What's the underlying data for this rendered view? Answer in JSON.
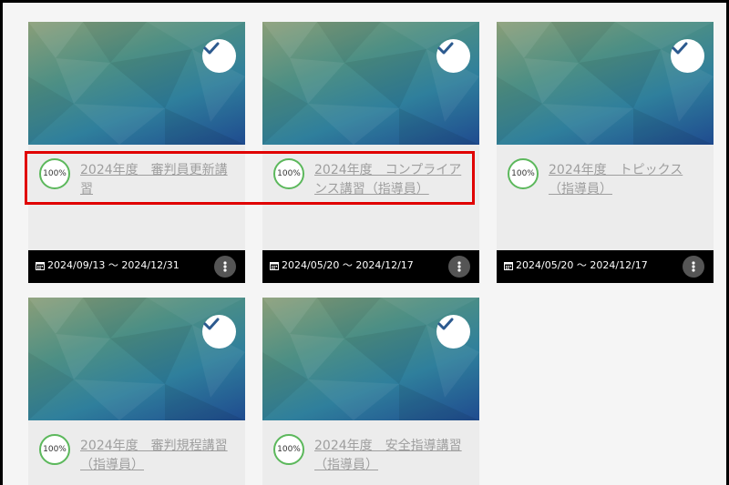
{
  "cards": [
    {
      "progress": "100%",
      "title": "2024年度　審判員更新講習",
      "date_range": "2024/09/13 ～ 2024/12/31",
      "completed": true
    },
    {
      "progress": "100%",
      "title": "2024年度　コンプライアンス講習（指導員）",
      "date_range": "2024/05/20 ～ 2024/12/17",
      "completed": true
    },
    {
      "progress": "100%",
      "title": "2024年度　トピックス（指導員）",
      "date_range": "2024/05/20 ～ 2024/12/17",
      "completed": true
    },
    {
      "progress": "100%",
      "title": "2024年度　審判規程講習（指導員）",
      "completed": true
    },
    {
      "progress": "100%",
      "title": "2024年度　安全指導講習（指導員）",
      "completed": true
    }
  ],
  "icons": {
    "check": "check-icon",
    "calendar": "calendar-icon",
    "menu": "vertical-ellipsis-icon"
  },
  "colors": {
    "progress_ring": "#5cb85c",
    "title_link": "#9e9e9e",
    "footer_bg": "#000000",
    "highlight": "#e00000"
  }
}
